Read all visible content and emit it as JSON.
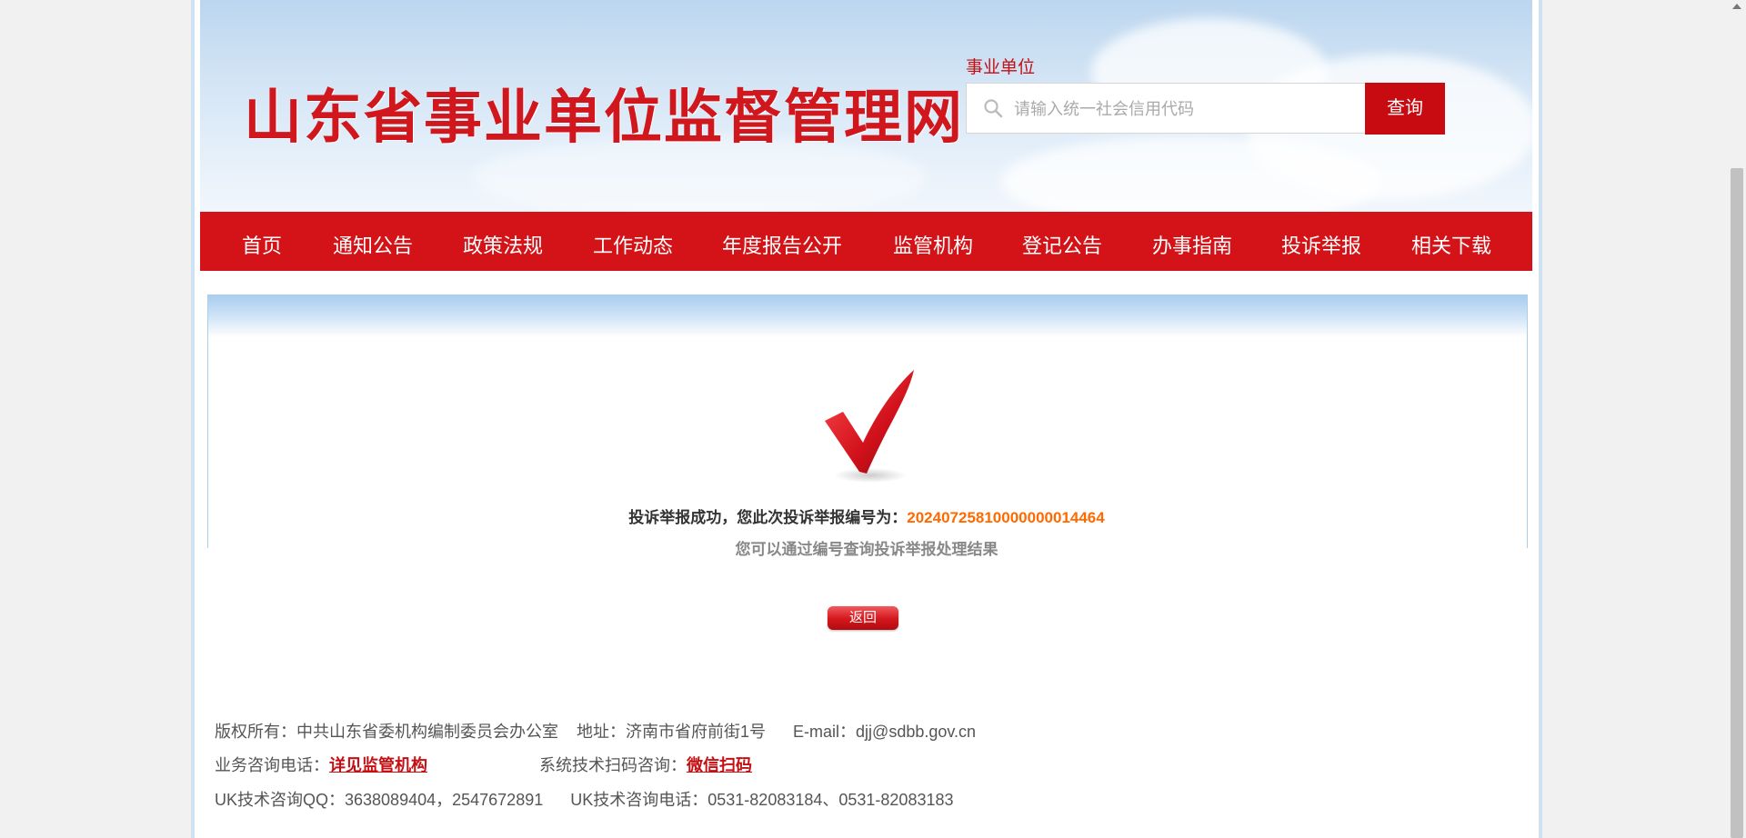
{
  "header": {
    "site_title": "山东省事业单位监督管理网",
    "search_label": "事业单位",
    "search_placeholder": "请输入统一社会信用代码",
    "search_button": "查询"
  },
  "nav": {
    "items": [
      "首页",
      "通知公告",
      "政策法规",
      "工作动态",
      "年度报告公开",
      "监管机构",
      "登记公告",
      "办事指南",
      "投诉举报",
      "相关下载"
    ]
  },
  "result": {
    "success_text": "投诉举报成功，您此次投诉举报编号为：",
    "report_id": "20240725810000000014464",
    "hint_text": "您可以通过编号查询投诉举报处理结果",
    "back_button": "返回"
  },
  "footer": {
    "copyright": "版权所有：中共山东省委机构编制委员会办公室",
    "address": "地址：济南市省府前街1号",
    "email": "E-mail：djj@sdbb.gov.cn",
    "biz_phone_label": "业务咨询电话：",
    "biz_phone_link": "详见监管机构",
    "tech_scan_label": "系统技术扫码咨询：",
    "tech_scan_link": "微信扫码",
    "uk_qq": "UK技术咨询QQ：3638089404，2547672891",
    "uk_phone": "UK技术咨询电话：0531-82083184、0531-82083183"
  },
  "colors": {
    "brand_red": "#d31317",
    "id_orange": "#ff6a00"
  }
}
